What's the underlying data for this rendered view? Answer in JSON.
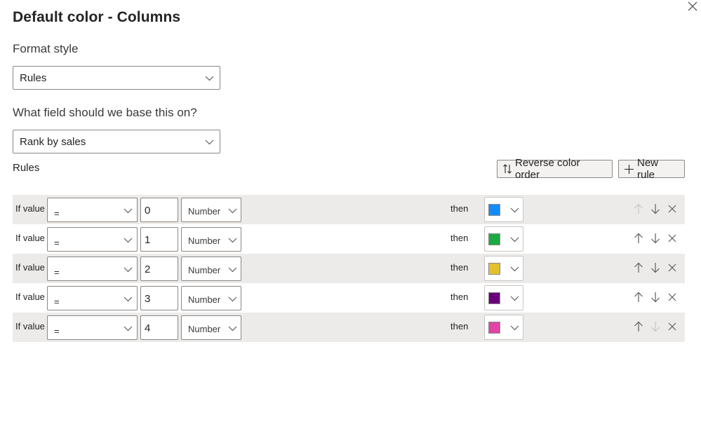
{
  "dialog": {
    "title": "Default color - Columns",
    "close_icon": "close-icon"
  },
  "format_style": {
    "label": "Format style",
    "selected": "Rules"
  },
  "base_field": {
    "label": "What field should we base this on?",
    "selected": "Rank by sales"
  },
  "rules_section": {
    "label": "Rules",
    "reverse_button": {
      "label": "Reverse color order",
      "icon": "sort-arrows-icon"
    },
    "new_rule_button": {
      "label": "New rule",
      "icon": "plus-icon"
    }
  },
  "rules": [
    {
      "if_label": "If value",
      "operator": "=",
      "value": "0",
      "type": "Number",
      "then_label": "then",
      "color": "#118dff",
      "move_up_enabled": false,
      "move_down_enabled": true
    },
    {
      "if_label": "If value",
      "operator": "=",
      "value": "1",
      "type": "Number",
      "then_label": "then",
      "color": "#1aab40",
      "move_up_enabled": true,
      "move_down_enabled": true
    },
    {
      "if_label": "If value",
      "operator": "=",
      "value": "2",
      "type": "Number",
      "then_label": "then",
      "color": "#e3c02e",
      "move_up_enabled": true,
      "move_down_enabled": true
    },
    {
      "if_label": "If value",
      "operator": "=",
      "value": "3",
      "type": "Number",
      "then_label": "then",
      "color": "#6b007b",
      "move_up_enabled": true,
      "move_down_enabled": true
    },
    {
      "if_label": "If value",
      "operator": "=",
      "value": "4",
      "type": "Number",
      "then_label": "then",
      "color": "#e044a7",
      "move_up_enabled": true,
      "move_down_enabled": false
    }
  ],
  "colors": {
    "text": "#252423",
    "border": "#8a8886",
    "row_shade": "#edebe9",
    "icon_enabled": "#605e5c",
    "icon_disabled": "#c8c6c4"
  }
}
